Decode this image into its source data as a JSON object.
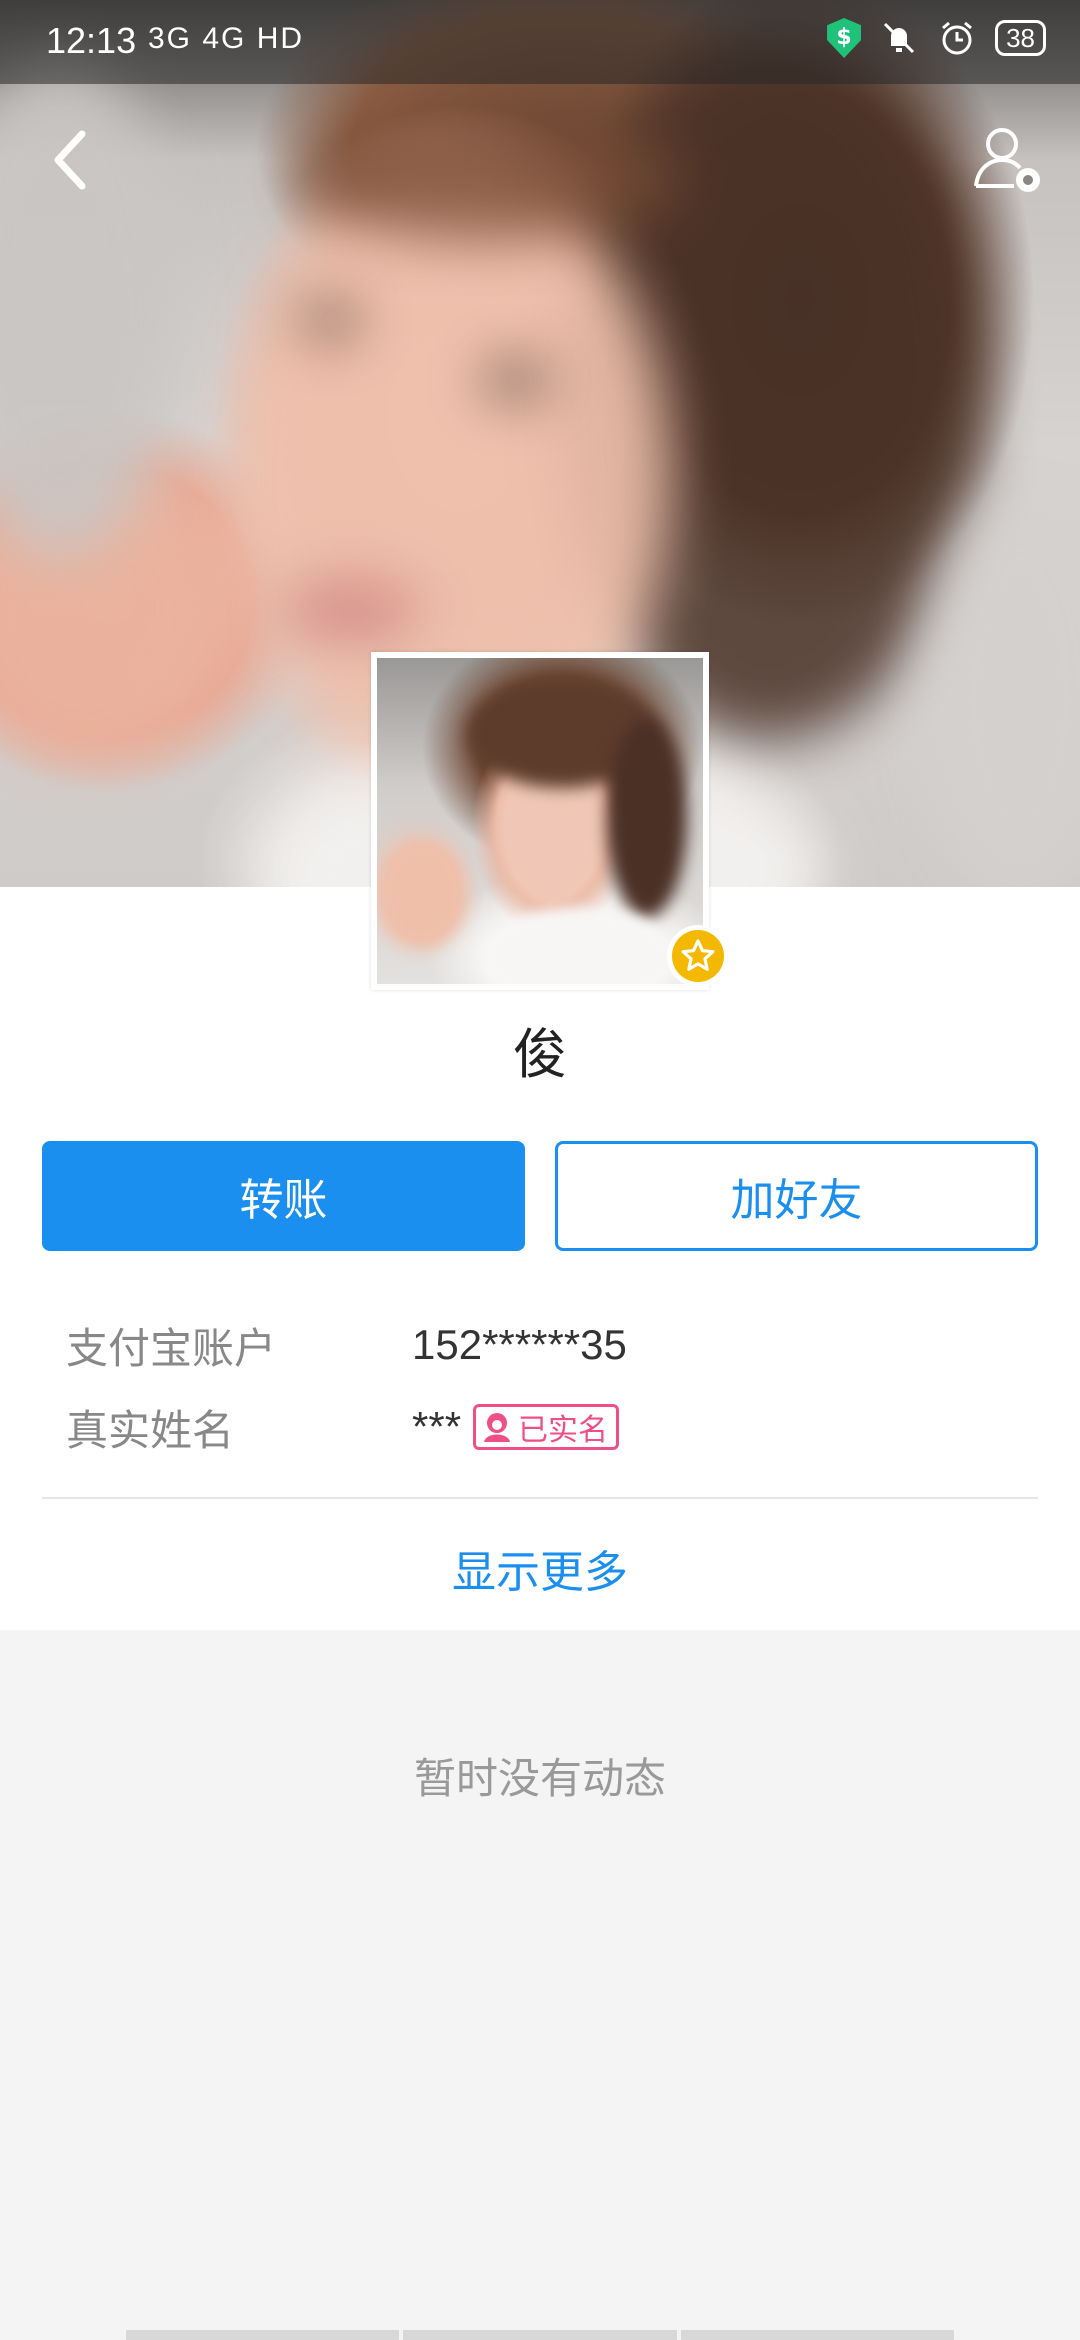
{
  "status_bar": {
    "time": "12:13",
    "network": "3G 4G HD",
    "battery": "38",
    "icons": [
      "shield-icon",
      "mute-icon",
      "alarm-icon",
      "battery-icon"
    ]
  },
  "header": {
    "back_icon": "chevron-left-icon",
    "settings_icon": "user-settings-icon"
  },
  "profile": {
    "name": "俊",
    "badge_icon": "star-icon"
  },
  "actions": {
    "transfer_label": "转账",
    "add_friend_label": "加好友"
  },
  "info": {
    "account_label": "支付宝账户",
    "account_value": "152******35",
    "realname_label": "真实姓名",
    "realname_value": "***",
    "verified_label": "已实名"
  },
  "show_more_label": "显示更多",
  "empty_feed_text": "暂时没有动态",
  "colors": {
    "accent": "#1a8ff0",
    "verified": "#ef4f86",
    "badge": "#f5b800"
  }
}
